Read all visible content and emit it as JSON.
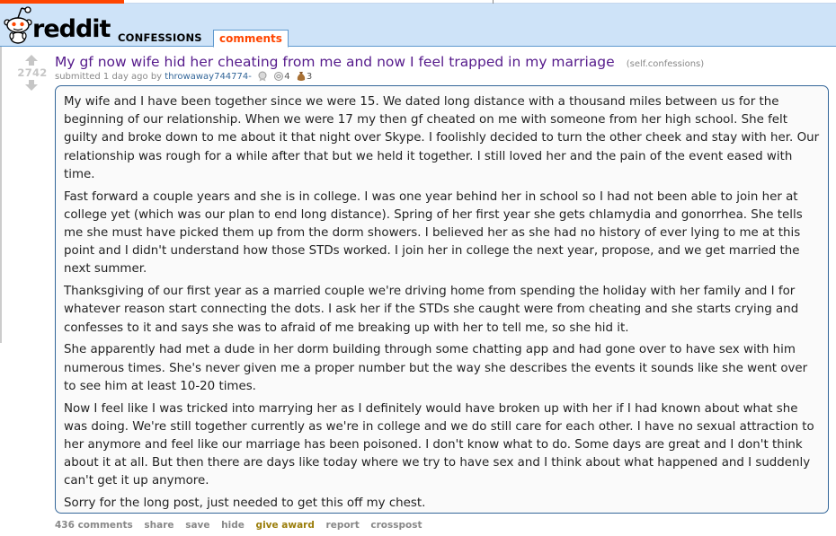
{
  "header": {
    "logo_text": "reddit",
    "subreddit": "CONFESSIONS",
    "active_tab": "comments"
  },
  "post": {
    "score": "2742",
    "title": "My gf now wife hid her cheating from me and now I feel trapped in my marriage",
    "domain": "(self.confessions)",
    "tagline_prefix": "submitted 1 day ago by",
    "author": "throwaway744774-",
    "award_counts": [
      "4",
      "3"
    ],
    "paragraphs": [
      "My wife and I have been together since we were 15. We dated long distance with a thousand miles between us for the beginning of our relationship. When we were 17 my then gf cheated on me with someone from her high school. She felt guilty and broke down to me about it that night over Skype. I foolishly decided to turn the other cheek and stay with her. Our relationship was rough for a while after that but we held it together. I still loved her and the pain of the event eased with time.",
      "Fast forward a couple years and she is in college. I was one year behind her in school so I had not been able to join her at college yet (which was our plan to end long distance). Spring of her first year she gets chlamydia and gonorrhea. She tells me she must have picked them up from the dorm showers. I believed her as she had no history of ever lying to me at this point and I didn't understand how those STDs worked. I join her in college the next year, propose, and we get married the next summer.",
      "Thanksgiving of our first year as a married couple we're driving home from spending the holiday with her family and I for whatever reason start connecting the dots. I ask her if the STDs she caught were from cheating and she starts crying and confesses to it and says she was to afraid of me breaking up with her to tell me, so she hid it.",
      "She apparently had met a dude in her dorm building through some chatting app and had gone over to have sex with him numerous times. She's never given me a proper number but the way she describes the events it sounds like she went over to see him at least 10-20 times.",
      "Now I feel like I was tricked into marrying her as I definitely would have broken up with her if I had known about what she was doing. We're still together currently as we're in college and we do still care for each other. I have no sexual attraction to her anymore and feel like our marriage has been poisoned. I don't know what to do. Some days are great and I don't think about it at all. But then there are days like today where we try to have sex and I think about what happened and I suddenly can't get it up anymore.",
      "Sorry for the long post, just needed to get this off my chest."
    ]
  },
  "actions": {
    "comments": "436 comments",
    "share": "share",
    "save": "save",
    "hide": "hide",
    "give_award": "give award",
    "report": "report",
    "crosspost": "crosspost"
  },
  "colors": {
    "header_bg": "#cee3f8",
    "tab_text": "#ff4500",
    "title": "#551a8b",
    "author": "#336699",
    "selftext_border": "#336699"
  },
  "icons": {
    "logo": "reddit-alien-icon",
    "upvote": "upvote-arrow-icon",
    "downvote": "downvote-arrow-icon",
    "award1": "silver-award-icon",
    "award2": "helpful-award-icon",
    "award3": "gold-bag-award-icon"
  }
}
